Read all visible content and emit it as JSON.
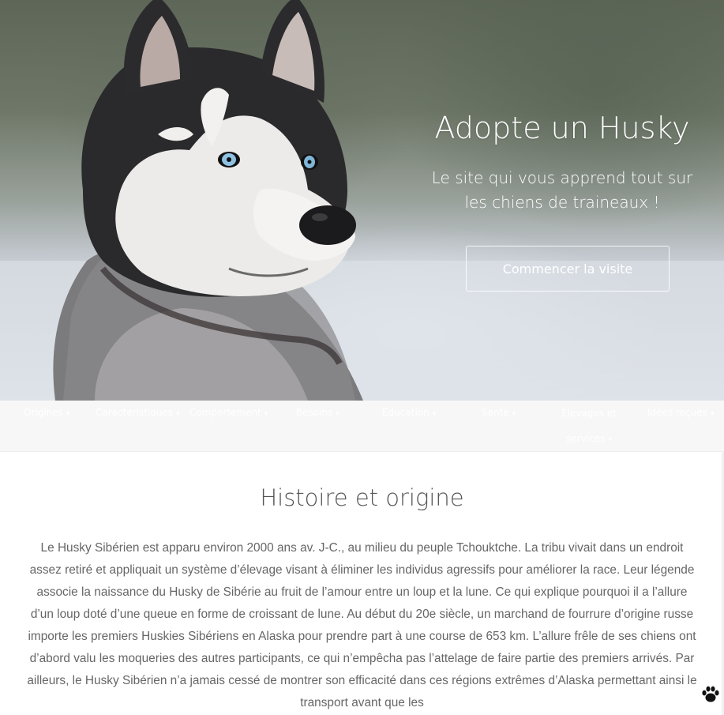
{
  "hero": {
    "title": "Adopte un Husky",
    "subtitle": "Le site qui vous apprend tout sur les chiens de traineaux !",
    "cta_label": "Commencer la visite",
    "image_icon": "husky-photo"
  },
  "nav": {
    "items": [
      {
        "label": "Origines",
        "caret": "▾"
      },
      {
        "label": "Caractéristiques",
        "caret": "▾"
      },
      {
        "label": "Comportement",
        "caret": "▾"
      },
      {
        "label": "Besoins",
        "caret": "▾"
      },
      {
        "label": "Éducation",
        "caret": "▾"
      },
      {
        "label": "Santé",
        "caret": "▾"
      },
      {
        "label": "Élevages et services",
        "caret": "▾"
      },
      {
        "label": "Idées reçues",
        "caret": "▾"
      }
    ]
  },
  "section": {
    "title": "Histoire et origine",
    "paragraph": "Le Husky Sibérien est apparu environ 2000 ans av. J-C., au milieu du peuple Tchouktche. La tribu vivait dans un endroit assez retiré et appliquait un système d’élevage visant à éliminer les individus agressifs pour améliorer la race. Leur légende associe la naissance du Husky de Sibérie au fruit de l’amour entre un loup et la lune. Ce qui explique pourquoi il a l’allure d’un loup doté d’une queue en forme de croissant de lune. Au début du 20e siècle, un marchand de fourrure d’origine russe importe les premiers Huskies Sibériens en Alaska pour prendre part à une course de 653 km. L’allure frêle de ses chiens ont d’abord valu les moqueries des autres participants, ce qui n’empêcha pas l’attelage de faire partie des premiers arrivés. Par ailleurs, le Husky Sibérien n’a jamais cessé de montrer son efficacité dans ces régions extrêmes d’Alaska permettant ainsi le transport avant que les"
  },
  "widgets": {
    "paw_icon": "paw-icon"
  },
  "colors": {
    "nav_bg": "#f7f7f7",
    "nav_text": "#ffffff",
    "body_text": "#666666",
    "title_text": "#555555"
  }
}
